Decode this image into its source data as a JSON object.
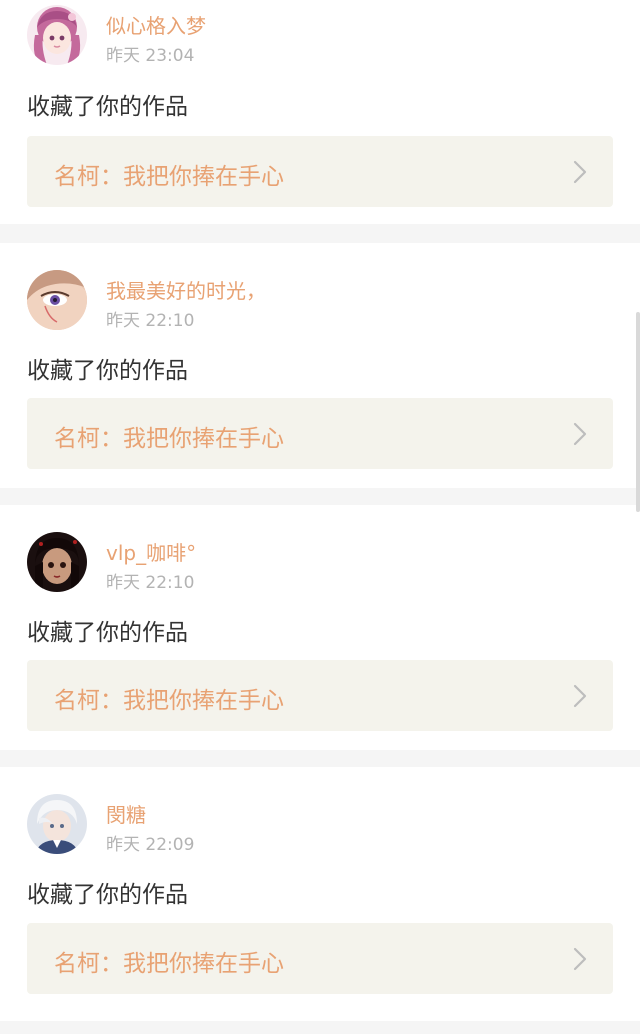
{
  "notifications": [
    {
      "avatar": "anime-girl-pink-hair-avatar",
      "username": "似心格入梦",
      "time": "昨天 23:04",
      "action": "收藏了你的作品",
      "work": {
        "title": "名柯：我把你捧在手心",
        "chevron": "chevron-right-icon"
      }
    },
    {
      "avatar": "face-closeup-eye-avatar",
      "username": "我最美好的时光，",
      "time": "昨天 22:10",
      "action": "收藏了你的作品",
      "work": {
        "title": "名柯：我把你捧在手心",
        "chevron": "chevron-right-icon"
      }
    },
    {
      "avatar": "dark-doll-face-avatar",
      "username": "vlp_咖啡°",
      "time": "昨天 22:10",
      "action": "收藏了你的作品",
      "work": {
        "title": "名柯：我把你捧在手心",
        "chevron": "chevron-right-icon"
      }
    },
    {
      "avatar": "white-hair-person-avatar",
      "username": "閔糖",
      "time": "昨天 22:09",
      "action": "收藏了你的作品",
      "work": {
        "title": "名柯：我把你捧在手心",
        "chevron": "chevron-right-icon"
      }
    }
  ],
  "colors": {
    "username": "#e8a273",
    "time": "#b3b3b3",
    "action_text": "#333333",
    "work_box_bg": "#f4f3ec",
    "page_bg": "#f5f5f5"
  }
}
